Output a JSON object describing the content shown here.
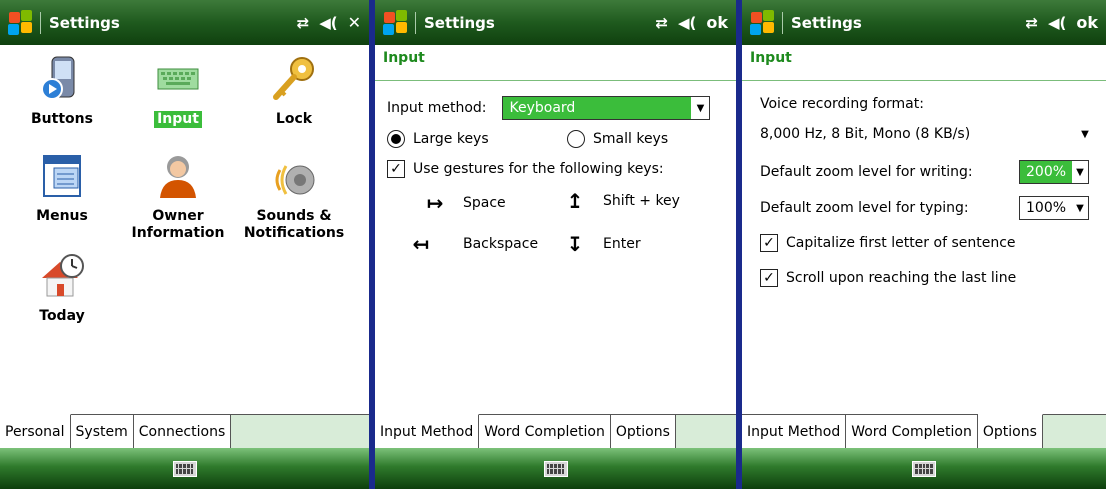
{
  "panels": [
    {
      "title": "Settings",
      "title_icons": [
        "connectivity-icon",
        "volume-icon"
      ],
      "title_button": "✕",
      "icons": [
        {
          "name": "buttons",
          "label": "Buttons"
        },
        {
          "name": "input",
          "label": "Input",
          "selected": true
        },
        {
          "name": "lock",
          "label": "Lock"
        },
        {
          "name": "menus",
          "label": "Menus"
        },
        {
          "name": "owner",
          "label": "Owner Information"
        },
        {
          "name": "sounds",
          "label": "Sounds & Notifications"
        },
        {
          "name": "today",
          "label": "Today"
        }
      ],
      "tabs": [
        {
          "label": "Personal",
          "active": true
        },
        {
          "label": "System"
        },
        {
          "label": "Connections"
        }
      ]
    },
    {
      "title": "Settings",
      "title_button": "ok",
      "header": "Input",
      "input_method_label": "Input method:",
      "input_method_value": "Keyboard",
      "large_keys": "Large keys",
      "small_keys": "Small keys",
      "gestures_label": "Use gestures for the following keys:",
      "gesture_space": "Space",
      "gesture_shift": "Shift + key",
      "gesture_backspace": "Backspace",
      "gesture_enter": "Enter",
      "tabs": [
        {
          "label": "Input Method",
          "active": true
        },
        {
          "label": "Word Completion"
        },
        {
          "label": "Options"
        }
      ]
    },
    {
      "title": "Settings",
      "title_button": "ok",
      "header": "Input",
      "voice_format_label": "Voice recording format:",
      "voice_format_value": "8,000 Hz, 8 Bit, Mono (8 KB/s)",
      "zoom_writing_label": "Default zoom level for writing:",
      "zoom_writing_value": "200%",
      "zoom_typing_label": "Default zoom level for typing:",
      "zoom_typing_value": "100%",
      "capitalize_label": "Capitalize first letter of sentence",
      "scroll_label": "Scroll upon reaching the last line",
      "tabs": [
        {
          "label": "Input Method"
        },
        {
          "label": "Word Completion"
        },
        {
          "label": "Options",
          "active": true
        }
      ]
    }
  ],
  "colors": {
    "titlebar": "#1f5a1e",
    "accent": "#3bbd3b",
    "header": "#1e8a1e",
    "divider": "#1a2a8c"
  }
}
